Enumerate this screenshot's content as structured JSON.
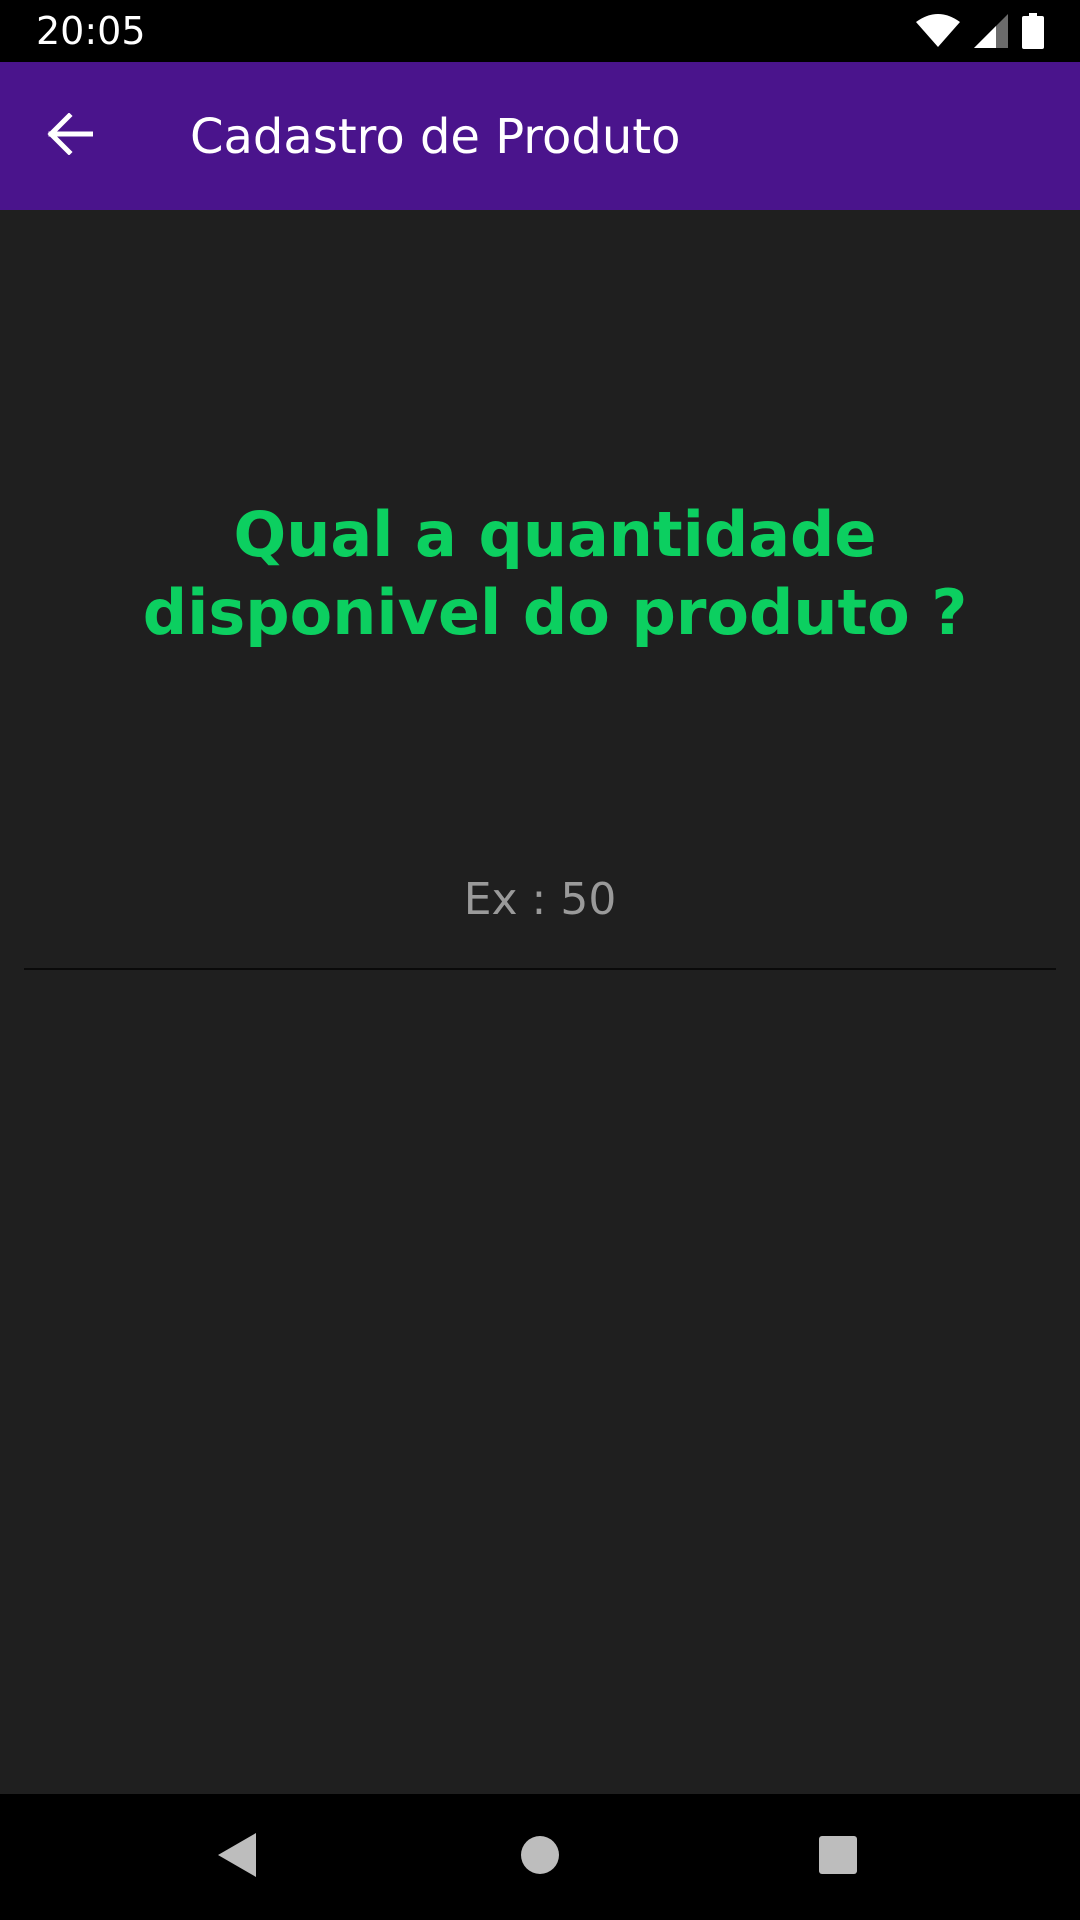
{
  "status_bar": {
    "time": "20:05",
    "icons": [
      "wifi-icon",
      "signal-icon",
      "battery-icon"
    ]
  },
  "app_bar": {
    "title": "Cadastro de Produto",
    "back_icon": "arrow-back-icon",
    "background_color": "#4a148c"
  },
  "main": {
    "question": "Qual a quantidade disponivel do produto ?",
    "question_color": "#0ccf60",
    "quantity_input": {
      "value": "",
      "placeholder": "Ex : 50"
    }
  },
  "nav_bar": {
    "icons": [
      "nav-back-icon",
      "nav-home-icon",
      "nav-recents-icon"
    ]
  },
  "colors": {
    "background": "#1f1f1f",
    "status_bar": "#000000",
    "nav_bar": "#000000"
  }
}
